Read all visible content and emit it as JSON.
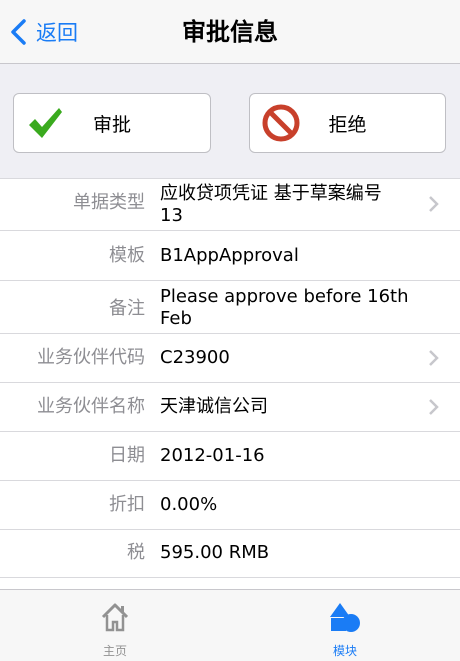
{
  "navbar": {
    "back_label": "返回",
    "title": "审批信息"
  },
  "actions": {
    "approve_label": "审批",
    "reject_label": "拒绝"
  },
  "rows": [
    {
      "label": "单据类型",
      "value": "应收贷项凭证 基于草案编号 13",
      "chevron": true
    },
    {
      "label": "模板",
      "value": "B1AppApproval",
      "chevron": false
    },
    {
      "label": "备注",
      "value": "Please approve before 16th Feb",
      "chevron": false
    },
    {
      "label": "业务伙伴代码",
      "value": "C23900",
      "chevron": true
    },
    {
      "label": "业务伙伴名称",
      "value": "天津诚信公司",
      "chevron": true
    },
    {
      "label": "日期",
      "value": "2012-01-16",
      "chevron": false
    },
    {
      "label": "折扣",
      "value": "0.00%",
      "chevron": false
    },
    {
      "label": "税",
      "value": "595.00 RMB",
      "chevron": false
    }
  ],
  "tabbar": {
    "home_label": "主页",
    "modules_label": "模块",
    "active_color": "#1a7cf5",
    "inactive_color": "#929292"
  },
  "colors": {
    "accent": "#1a7cf5",
    "approve_check": "#3aaa1e",
    "reject_red": "#c8402b"
  }
}
